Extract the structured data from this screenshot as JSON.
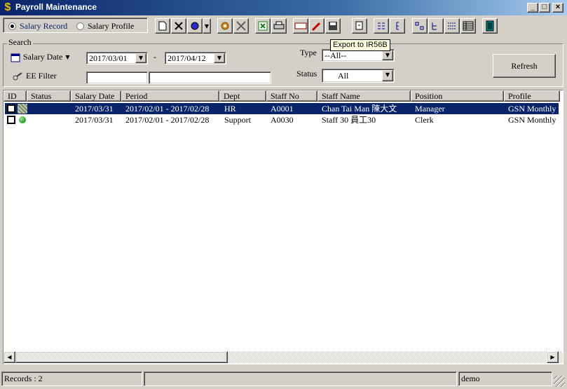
{
  "window": {
    "title": "Payroll Maintenance",
    "icon": "dollar-sign-icon",
    "minimize": "_",
    "maximize": "□",
    "close": "×"
  },
  "mode": {
    "salary_record": "Salary Record",
    "salary_profile": "Salary Profile",
    "selected": "salary_record"
  },
  "toolbar": {
    "tooltip": "Export to IR56B"
  },
  "search": {
    "group_label": "Search",
    "salary_date_label": "Salary Date",
    "date_from": "2017/03/01",
    "date_separator": "-",
    "date_to": "2017/04/12",
    "ee_filter_label": "EE Filter",
    "ee_filter_value_1": "",
    "ee_filter_value_2": "",
    "type_label": "Type",
    "type_value": "--All--",
    "status_label": "Status",
    "status_value": "All",
    "refresh_label": "Refresh"
  },
  "grid": {
    "columns": [
      "ID",
      "Status",
      "Salary Date",
      "Period",
      "Dept",
      "Staff No",
      "Staff Name",
      "Position",
      "Profile"
    ],
    "rows": [
      {
        "salary_date": "2017/03/31",
        "period": "2017/02/01 - 2017/02/28",
        "dept": "HR",
        "staff_no": "A0001",
        "staff_name": "Chan Tai Man 陳大文",
        "position": "Manager",
        "profile": "GSN Monthly",
        "status_icon": "hatched-status-icon",
        "selected": true
      },
      {
        "salary_date": "2017/03/31",
        "period": "2017/02/01 - 2017/02/28",
        "dept": "Support",
        "staff_no": "A0030",
        "staff_name": "Staff 30 員工30",
        "position": "Clerk",
        "profile": "GSN Monthly",
        "status_icon": "green-dot-icon",
        "selected": false
      }
    ]
  },
  "statusbar": {
    "records": "Records : 2",
    "middle": "",
    "user": "demo"
  },
  "colors": {
    "title_start": "#0a246a",
    "title_end": "#a6caf0",
    "selection": "#0a246a",
    "face": "#d4d0c8",
    "status_green": "#2fa52f"
  }
}
